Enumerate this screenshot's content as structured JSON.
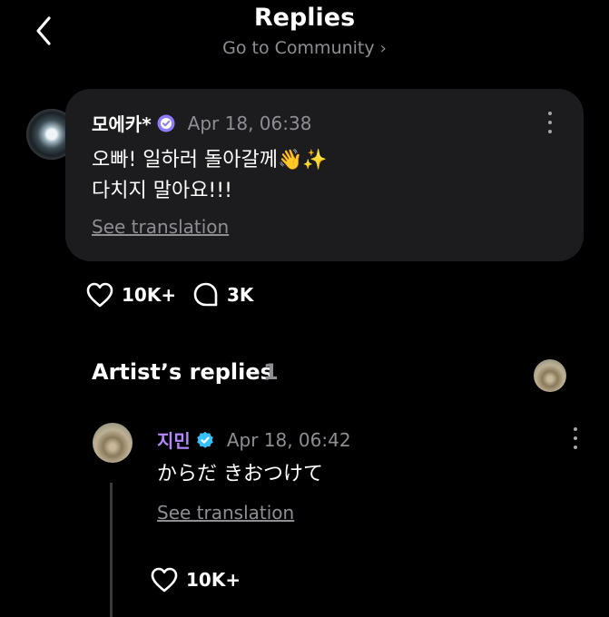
{
  "header": {
    "title": "Replies",
    "subtitle": "Go to Community",
    "subtitle_chevron": "›"
  },
  "post": {
    "author": "모에카*",
    "timestamp": "Apr 18, 06:38",
    "message": "오빠! 일하러 돌아갈께👋✨\n다치지 말아요!!!",
    "see_translation": "See translation",
    "likes": "10K+",
    "comments": "3K",
    "badge_color": "#8e7cff"
  },
  "artist_replies": {
    "title": "Artist’s replies",
    "count": "1"
  },
  "reply": {
    "author": "지민",
    "timestamp": "Apr 18, 06:42",
    "message": "からだ きおつけて",
    "see_translation": "See translation",
    "likes": "10K+",
    "author_color": "#b388ff",
    "badge_color": "#35c3ff"
  }
}
